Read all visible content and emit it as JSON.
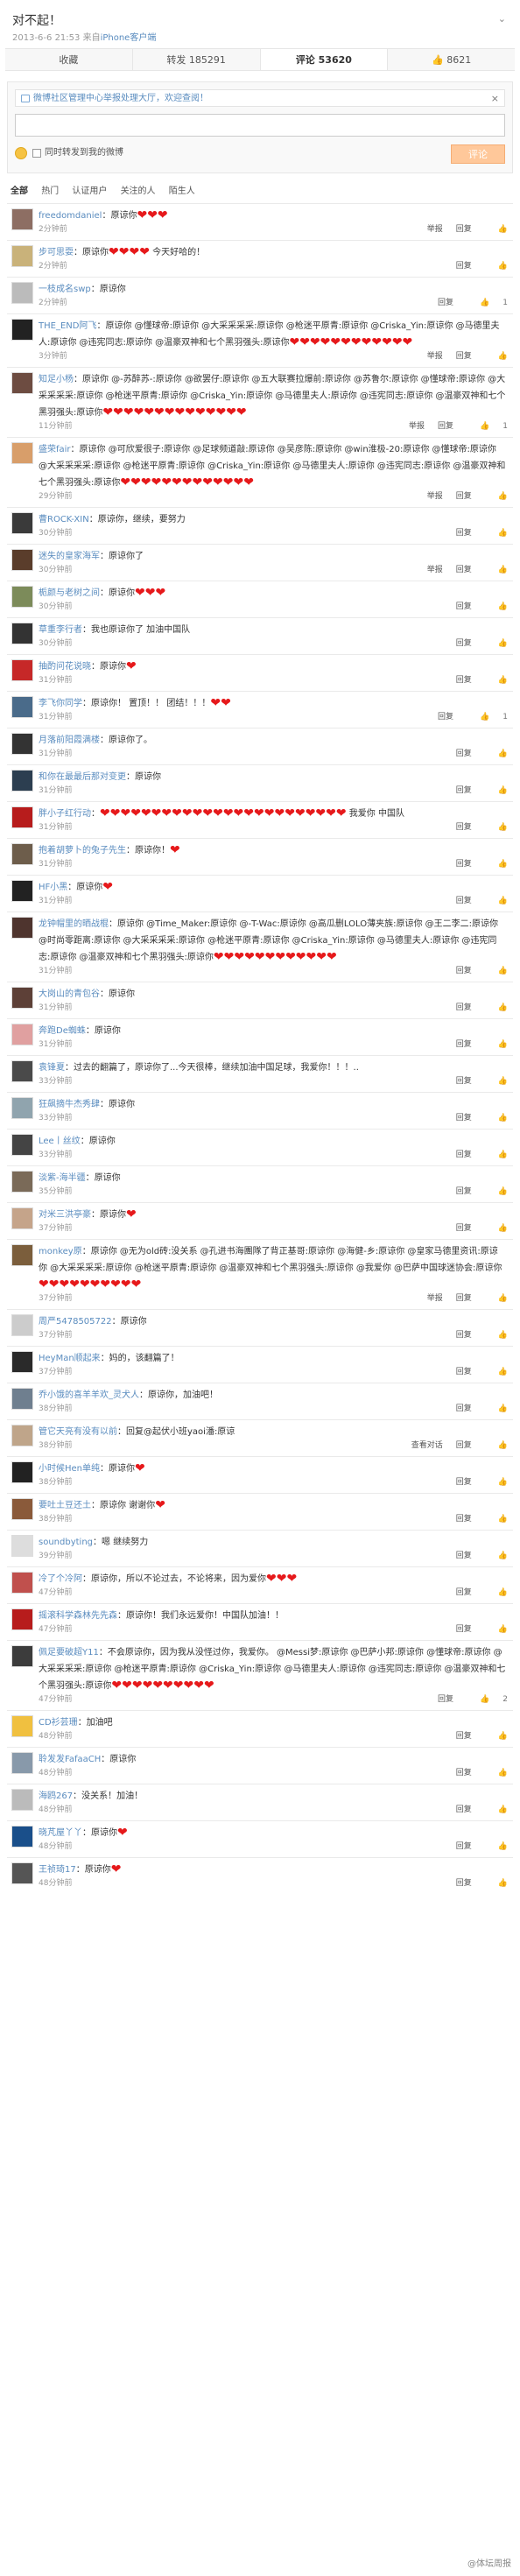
{
  "post": {
    "title": "对不起！",
    "time": "2013-6-6 21:53",
    "source_prefix": "来自",
    "source": "iPhone客户端"
  },
  "tabs": [
    "收藏",
    "转发 185291",
    "评论 53620",
    "8621"
  ],
  "composer": {
    "notice": "微博社区管理中心举报处理大厅，欢迎查阅！",
    "close": "×",
    "placeholder": "",
    "also_forward": "同时转发到我的微博",
    "button": "评论"
  },
  "filters": [
    "全部",
    "热门",
    "认证用户",
    "关注的人",
    "陌生人"
  ],
  "comments": [
    {
      "name": "freedomdaniel",
      "text": "：原谅你",
      "h": 3,
      "time": "2分钟前",
      "foot": [
        "举报",
        "回复",
        ""
      ]
    },
    {
      "name": "步可思耍",
      "text": "：原谅你",
      "h": 4,
      "tail": "今天好哈的！",
      "time": "2分钟前",
      "foot": [
        "回复",
        ""
      ]
    },
    {
      "name": "一枝成名swp",
      "text": "：原谅你",
      "time": "2分钟前",
      "foot": [
        "回复",
        "1"
      ]
    },
    {
      "name": "THE_END阿飞",
      "text": "：原谅你 @懂球帝:原谅你 @大采采采采:原谅你 @枪迷平原青:原谅你 @Criska_Yin:原谅你 @马德里夫人:原谅你 @违宪同志:原谅你 @温豪双神和七个黑羽强头:原谅你",
      "h": 12,
      "time": "3分钟前",
      "foot": [
        "举报",
        "回复",
        ""
      ]
    },
    {
      "name": "知足小杨",
      "text": "：原谅你 @-苏醉苏-:原谅你 @欲罢仔:原谅你 @五大联赛拉爆前:原谅你 @苏鲁尔:原谅你 @懂球帝:原谅你 @大采采采采:原谅你 @枪迷平原青:原谅你 @Criska_Yin:原谅你 @马德里夫人:原谅你 @违宪同志:原谅你 @温豪双神和七个黑羽强头:原谅你",
      "h": 14,
      "time": "11分钟前",
      "foot": [
        "举报",
        "回复",
        "1"
      ]
    },
    {
      "name": "盛荣fair",
      "text": "：原谅你 @可欣爱很子:原谅你 @足球频道敲:原谅你 @吴彦陈:原谅你 @win淮极-20:原谅你 @懂球帝:原谅你 @大采采采采:原谅你 @枪迷平原青:原谅你 @Criska_Yin:原谅你 @马德里夫人:原谅你 @违宪同志:原谅你 @温豪双神和七个黑羽强头:原谅你",
      "h": 13,
      "time": "29分钟前",
      "foot": [
        "举报",
        "回复",
        ""
      ]
    },
    {
      "name": "曹ROCK-XIN",
      "text": "：原谅你，继续，要努力",
      "time": "30分钟前",
      "foot": [
        "回复",
        ""
      ]
    },
    {
      "name": "迷失的皇家海军",
      "text": "：原谅你了",
      "time": "30分钟前",
      "foot": [
        "举报",
        "回复",
        ""
      ]
    },
    {
      "name": "栀颜与老树之间",
      "text": "：原谅你",
      "h": 3,
      "time": "30分钟前",
      "foot": [
        "回复",
        ""
      ]
    },
    {
      "name": "草重李行者",
      "text": "：我也原谅你了 加油中国队",
      "time": "30分钟前",
      "foot": [
        "回复",
        ""
      ]
    },
    {
      "name": "抽酌问花说晓",
      "text": "：原谅你",
      "h": 1,
      "time": "31分钟前",
      "foot": [
        "回复",
        ""
      ]
    },
    {
      "name": "李飞你同学",
      "text": "：原谅你！ 置顶！！ 团结！！！",
      "h": 2,
      "time": "31分钟前",
      "foot": [
        "回复",
        "1"
      ]
    },
    {
      "name": "月落前阳霞满楼",
      "text": "：原谅你了。",
      "time": "31分钟前",
      "foot": [
        "回复",
        ""
      ]
    },
    {
      "name": "和你在最最后那对变更",
      "text": "：原谅你",
      "time": "31分钟前",
      "foot": [
        "回复",
        ""
      ]
    },
    {
      "name": "胖小子红行动",
      "text": "：",
      "h": 24,
      "tail": "我爱你 中国队",
      "time": "31分钟前",
      "foot": [
        "回复",
        ""
      ]
    },
    {
      "name": "抱着胡萝卜的兔子先生",
      "text": "：原谅你！",
      "h": 1,
      "time": "31分钟前",
      "foot": [
        "回复",
        ""
      ]
    },
    {
      "name": "HF小黑",
      "text": "：原谅你",
      "h": 1,
      "time": "31分钟前",
      "foot": [
        "回复",
        ""
      ]
    },
    {
      "name": "龙钟帽里的晒战棍",
      "text": "：原谅你 @Time_Maker:原谅你 @-T-Wac:原谅你 @高瓜删LOLO薄夹族:原谅你 @王二李二:原谅你 @时尚零距离:原谅你 @大采采采采:原谅你 @枪迷平原青:原谅你 @Criska_Yin:原谅你 @马德里夫人:原谅你 @违宪同志:原谅你 @温豪双神和七个黑羽强头:原谅你",
      "h": 12,
      "time": "31分钟前",
      "foot": [
        "回复",
        ""
      ]
    },
    {
      "name": "大岗山的青包谷",
      "text": "：原谅你",
      "time": "31分钟前",
      "foot": [
        "回复",
        ""
      ]
    },
    {
      "name": "奔跑De蜘蛛",
      "text": "：原谅你",
      "time": "31分钟前",
      "foot": [
        "回复",
        ""
      ]
    },
    {
      "name": "袁锋夏",
      "text": "：过去的翻篇了，原谅你了...今天很棒，继续加油中国足球，我爱你！！！..",
      "time": "33分钟前",
      "foot": [
        "回复",
        ""
      ]
    },
    {
      "name": "狂飙摘牛杰秀肆",
      "text": "：原谅你",
      "time": "33分钟前",
      "foot": [
        "回复",
        ""
      ]
    },
    {
      "name": "Lee丨丝纹",
      "text": "：原谅你",
      "time": "33分钟前",
      "foot": [
        "回复",
        ""
      ]
    },
    {
      "name": "淡紫-海半疆",
      "text": "：原谅你",
      "time": "35分钟前",
      "foot": [
        "回复",
        ""
      ]
    },
    {
      "name": "对米三洪亭豪",
      "text": "：原谅你",
      "h": 1,
      "time": "37分钟前",
      "foot": [
        "回复",
        ""
      ]
    },
    {
      "name": "monkey原",
      "text": "：原谅你 @无为old砖:没关系 @孔进书海團隊了背正基哥:原谅你 @海健-乡:原谅你 @皇家马德里资讯:原谅你 @大采采采采:原谅你 @枪迷平原青:原谅你 @温豪双神和七个黑羽强头:原谅你 @我爱你 @巴萨中国球迷协会:原谅你",
      "h": 10,
      "time": "37分钟前",
      "foot": [
        "举报",
        "回复",
        ""
      ]
    },
    {
      "name": "周严5478505722",
      "text": "：原谅你",
      "time": "37分钟前",
      "foot": [
        "回复",
        ""
      ]
    },
    {
      "name": "HeyMan顺起来",
      "text": "：妈的，该翻篇了！",
      "time": "37分钟前",
      "foot": [
        "回复",
        ""
      ]
    },
    {
      "name": "乔小饿的喜羊羊欢_灵犬人",
      "text": "：原谅你，加油吧！",
      "time": "38分钟前",
      "foot": [
        "回复",
        ""
      ]
    },
    {
      "name": "管它天亮有没有以前",
      "text": "：回复@起伏小班yaoi潘:原谅",
      "time": "38分钟前",
      "foot": [
        "查看对话",
        "回复",
        ""
      ]
    },
    {
      "name": "小时候Hen单纯",
      "text": "：原谅你",
      "h": 1,
      "time": "38分钟前",
      "foot": [
        "回复",
        ""
      ]
    },
    {
      "name": "要吐土豆还土",
      "text": "：原谅你 谢谢你",
      "h": 1,
      "time": "38分钟前",
      "foot": [
        "回复",
        ""
      ]
    },
    {
      "name": "soundbyting",
      "text": "：嗯 继续努力",
      "time": "39分钟前",
      "foot": [
        "回复",
        ""
      ]
    },
    {
      "name": "冷了个冷阿",
      "text": "：原谅你，所以不论过去，不论将来，因为爱你",
      "h": 3,
      "time": "47分钟前",
      "foot": [
        "回复",
        ""
      ]
    },
    {
      "name": "摇滚科学森林先先森",
      "text": "：原谅你！我们永远爱你！中国队加油！！",
      "time": "47分钟前",
      "foot": [
        "回复",
        ""
      ]
    },
    {
      "name": "佩足要破超Y11",
      "text": "：不会原谅你，因为我从没怪过你，我爱你。 @Messi梦:原谅你 @巴萨小邦:原谅你 @懂球帝:原谅你 @大采采采采:原谅你 @枪迷平原青:原谅你 @Criska_Yin:原谅你 @马德里夫人:原谅你 @违宪同志:原谅你 @温豪双神和七个黑羽强头:原谅你",
      "h": 10,
      "time": "47分钟前",
      "foot": [
        "回复",
        "2"
      ]
    },
    {
      "name": "CD衫芸珊",
      "text": "：加油吧",
      "time": "48分钟前",
      "foot": [
        "回复",
        ""
      ]
    },
    {
      "name": "聆发发FafaaCH",
      "text": "：原谅你",
      "time": "48分钟前",
      "foot": [
        "回复",
        ""
      ]
    },
    {
      "name": "海鸥267",
      "text": "：没关系！加油！",
      "time": "48分钟前",
      "foot": [
        "回复",
        ""
      ]
    },
    {
      "name": "晓芃屋丫丫",
      "text": "：原谅你",
      "h": 1,
      "time": "48分钟前",
      "foot": [
        "回复",
        ""
      ]
    },
    {
      "name": "王祯琦17",
      "text": "：原谅你",
      "h": 1,
      "time": "48分钟前",
      "foot": [
        "回复",
        ""
      ]
    }
  ],
  "watermark": "@体坛周报",
  "colors": {
    "link": "#5a8cbf",
    "heart": "#e6191b",
    "button": "#ffc89a"
  }
}
